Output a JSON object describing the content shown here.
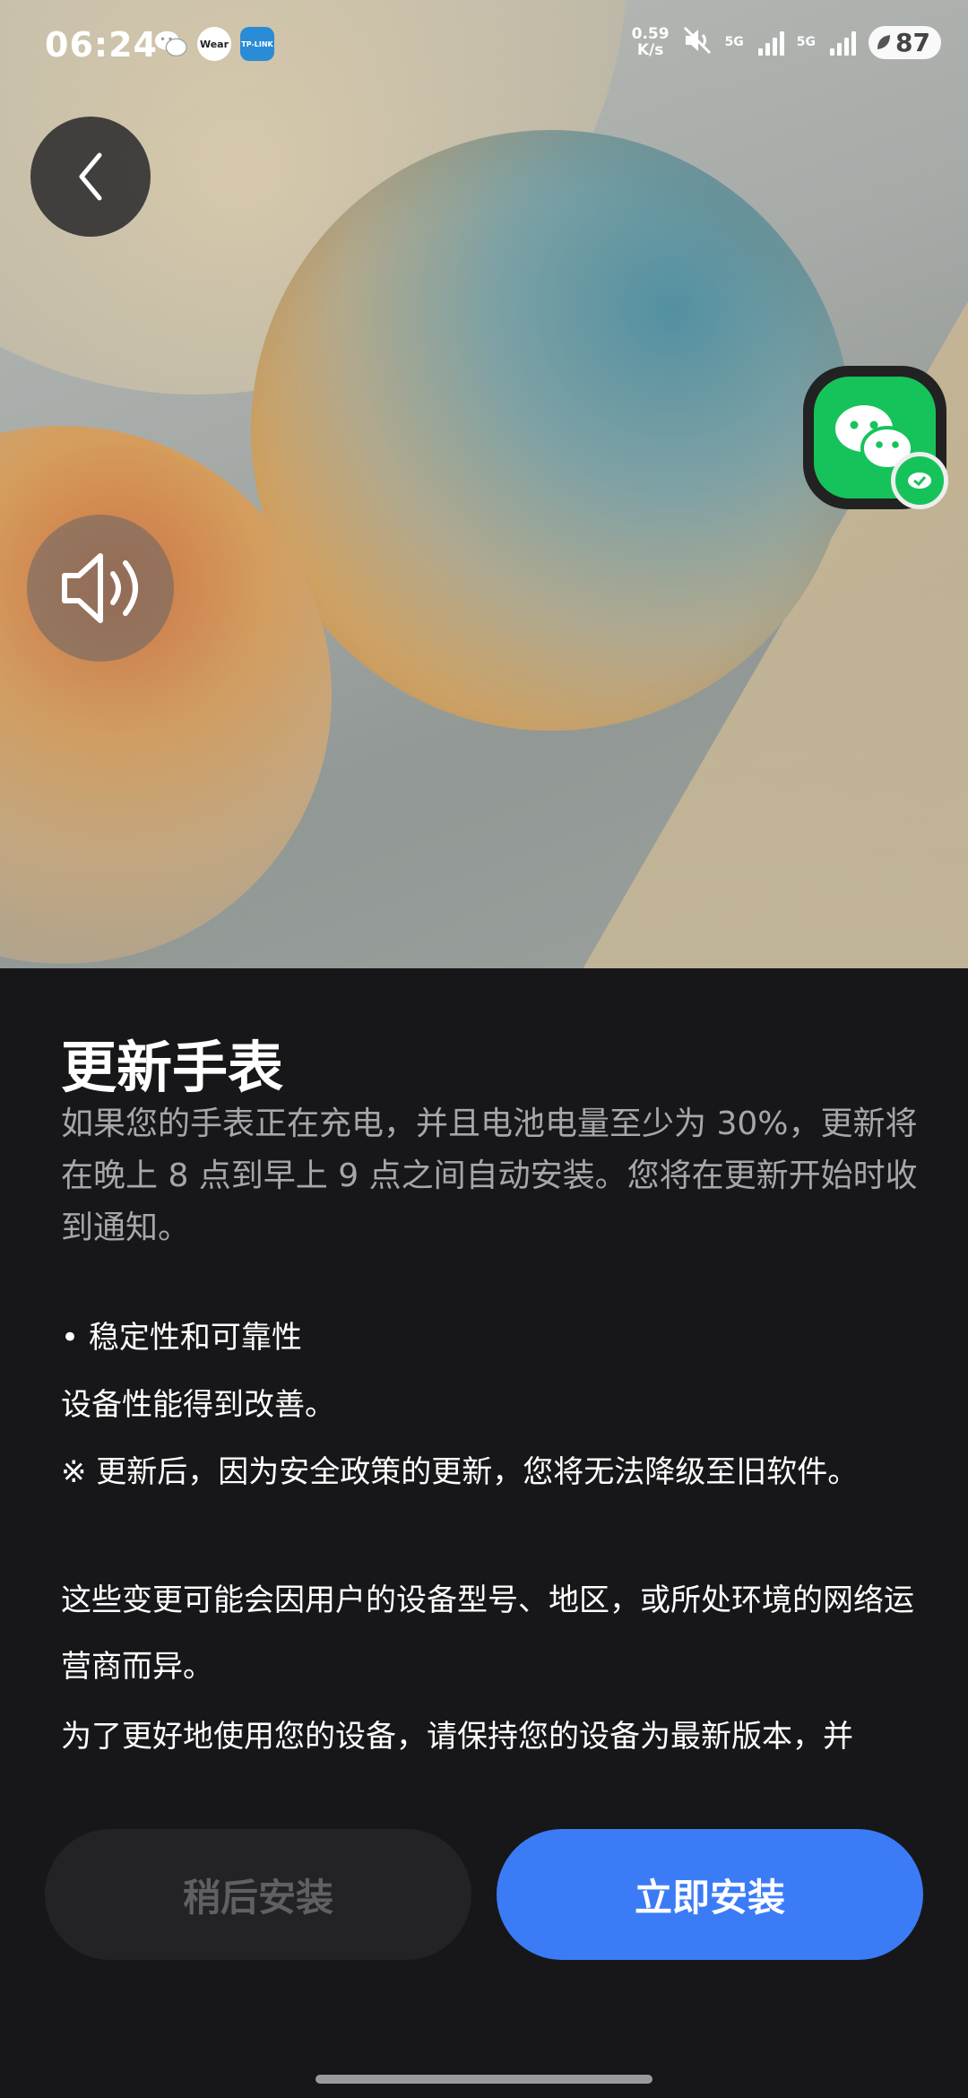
{
  "status_bar": {
    "time": "06:24",
    "apps": [
      {
        "name": "wechat-icon"
      },
      {
        "name": "wear-icon",
        "label": "Wear"
      },
      {
        "name": "tplink-icon",
        "label": "TP-LINK"
      }
    ],
    "net_speed_value": "0.59",
    "net_speed_unit": "K/s",
    "network_1": "5G",
    "network_2": "5G",
    "battery": "87"
  },
  "page": {
    "title": "更新手表",
    "intro": "如果您的手表正在充电，并且电池电量至少为 30%，更新将在晚上 8 点到早上 9 点之间自动安装。您将在更新开始时收到通知。",
    "bullet_title": "• 稳定性和可靠性",
    "bullet_desc": "设备性能得到改善。",
    "note": "※ 更新后，因为安全政策的更新，您将无法降级至旧软件。",
    "disclaimer": "这些变更可能会因用户的设备型号、地区，或所处环境的网络运营商而异。",
    "advice": "为了更好地使用您的设备，请保持您的设备为最新版本，并"
  },
  "buttons": {
    "later": "稍后安装",
    "now": "立即安装"
  },
  "colors": {
    "primary": "#3b7cf6",
    "background": "#17171a",
    "wechat_green": "#16c35b"
  }
}
